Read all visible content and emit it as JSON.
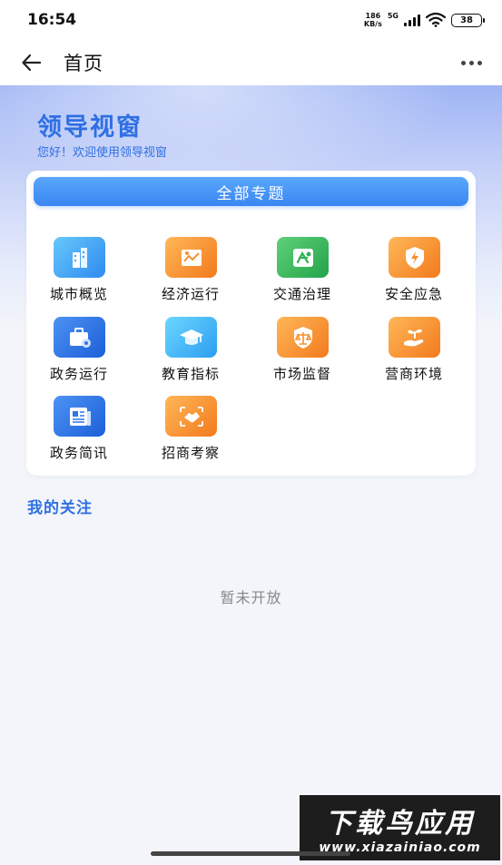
{
  "status_bar": {
    "time": "16:54",
    "speed_value": "186",
    "speed_unit": "KB/s",
    "network": "5G",
    "battery": "38"
  },
  "nav": {
    "title": "首页"
  },
  "hero": {
    "title": "领导视窗",
    "subtitle": "您好！欢迎使用领导视窗"
  },
  "topics": {
    "button_label": "全部专题",
    "items": [
      {
        "label": "城市概览",
        "icon": "city-building-icon",
        "color": "#3fa6f6"
      },
      {
        "label": "经济运行",
        "icon": "economy-chart-icon",
        "color": "#f5902f"
      },
      {
        "label": "交通治理",
        "icon": "traffic-route-icon",
        "color": "#2fb356"
      },
      {
        "label": "安全应急",
        "icon": "shield-lightning-icon",
        "color": "#f5902f"
      },
      {
        "label": "政务运行",
        "icon": "briefcase-gear-icon",
        "color": "#2f76e8"
      },
      {
        "label": "教育指标",
        "icon": "graduation-cap-icon",
        "color": "#3fa6f6"
      },
      {
        "label": "市场监督",
        "icon": "scale-shield-icon",
        "color": "#f5902f"
      },
      {
        "label": "营商环境",
        "icon": "hand-plant-icon",
        "color": "#f5902f"
      },
      {
        "label": "政务简讯",
        "icon": "newspaper-icon",
        "color": "#2f76e8"
      },
      {
        "label": "招商考察",
        "icon": "handshake-icon",
        "color": "#f5902f"
      }
    ]
  },
  "my_follow": {
    "title": "我的关注",
    "empty_text": "暂未开放"
  },
  "watermark": {
    "title": "下载鸟应用",
    "url": "www.xiazainiao.com"
  }
}
